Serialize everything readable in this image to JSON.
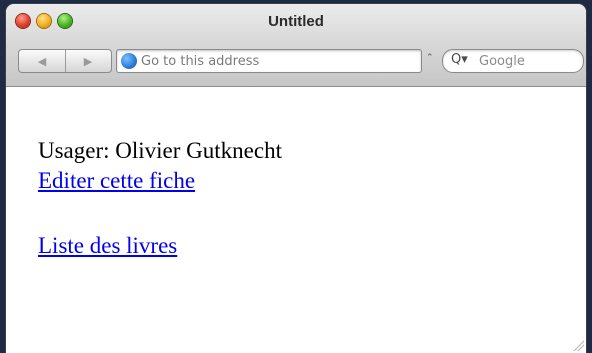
{
  "window": {
    "title": "Untitled"
  },
  "toolbar": {
    "back_icon": "◀",
    "forward_icon": "▶",
    "address_placeholder": "Go to this address",
    "snapback_icon": "⌃",
    "search_placeholder": "Google",
    "search_icon": "Q▾"
  },
  "page": {
    "user_line": "Usager: Olivier Gutknecht",
    "edit_link": "Editer cette fiche",
    "books_link": "Liste des livres"
  },
  "colors": {
    "link": "#0000ee",
    "background": "#1f2a44"
  }
}
